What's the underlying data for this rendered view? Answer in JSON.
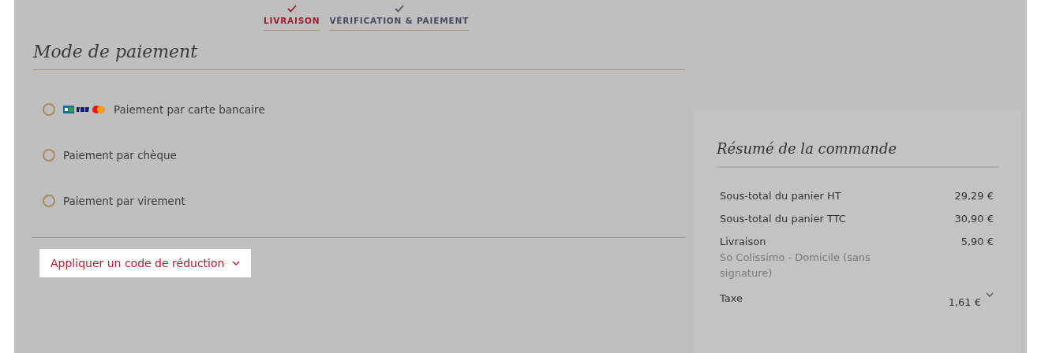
{
  "steps": [
    {
      "label": "LIVRAISON",
      "selected": true
    },
    {
      "label": "VÉRIFICATION & PAIEMENT",
      "selected": false
    }
  ],
  "payment": {
    "title": "Mode de paiement",
    "methods": [
      {
        "label": "Paiement par carte bancaire",
        "kind": "card",
        "selected": false
      },
      {
        "label": "Paiement par chèque",
        "kind": "plain",
        "selected": false
      },
      {
        "label": "Paiement par virement",
        "kind": "plain",
        "selected": false
      }
    ],
    "discount_button": "Appliquer un code de réduction"
  },
  "summary": {
    "title": "Résumé de la commande",
    "rows": [
      {
        "label": "Sous-total du panier HT",
        "value": "29,29 €",
        "kind": "plain"
      },
      {
        "label": "Sous-total du panier TTC",
        "value": "30,90 €",
        "kind": "plain"
      },
      {
        "label": "Livraison",
        "sublabel": "So Colissimo - Domicile (sans signature)",
        "value": "5,90 €",
        "kind": "plain"
      },
      {
        "label": "Taxe",
        "value": "1,61 €",
        "kind": "expandable"
      }
    ]
  }
}
